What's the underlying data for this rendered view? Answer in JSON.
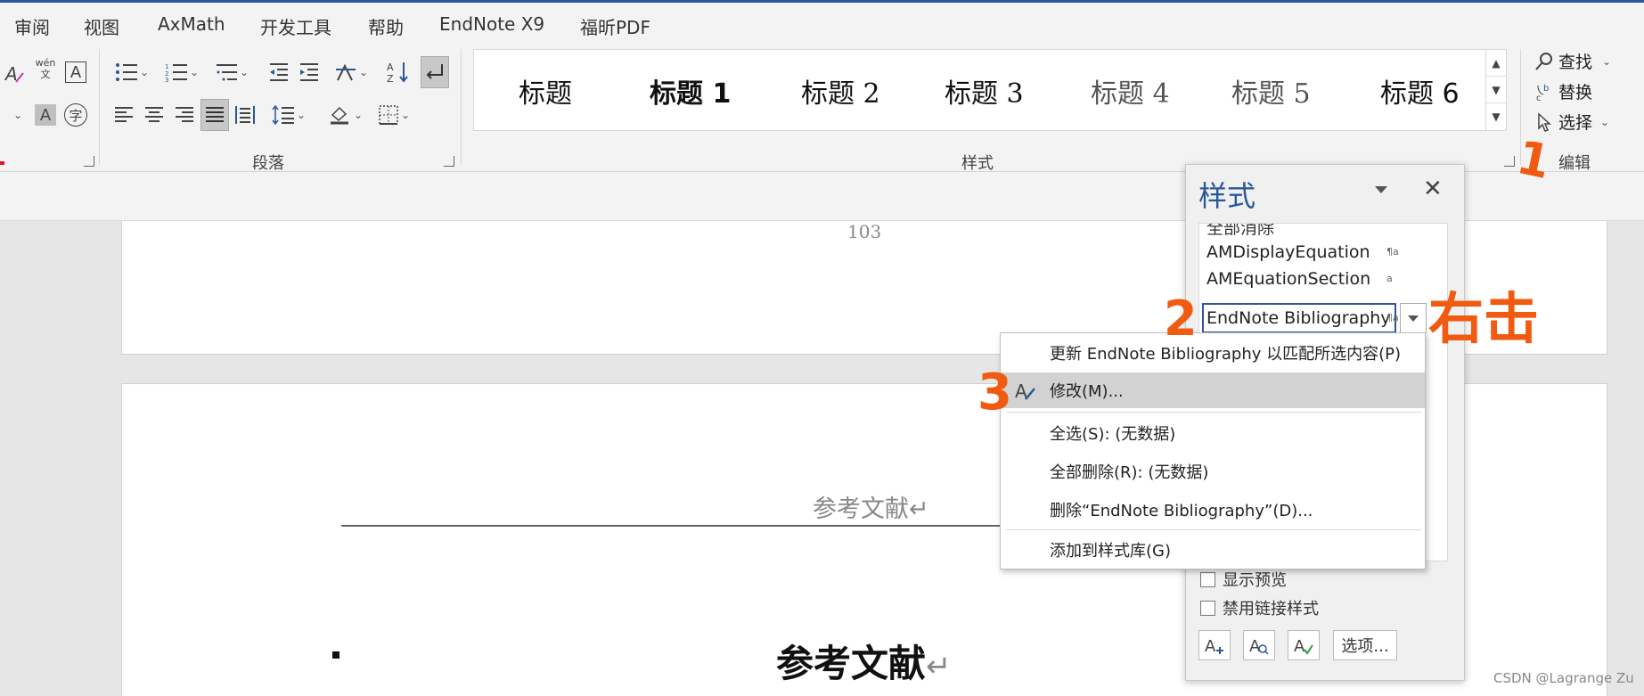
{
  "menu": {
    "tabs": [
      "审阅",
      "视图",
      "AxMath",
      "开发工具",
      "帮助",
      "EndNote X9",
      "福昕PDF"
    ]
  },
  "ribbon": {
    "paragraph_group_label": "段落",
    "styles_group_label": "样式",
    "editing_group_label": "编辑",
    "style_gallery": [
      "标题",
      "标题 1",
      "标题 2",
      "标题 3",
      "标题 4",
      "标题 5",
      "标题 6"
    ],
    "editing": {
      "find": "查找",
      "replace": "替换",
      "select": "选择"
    },
    "font_glyphs": {
      "phonetic_top": "wén",
      "phonetic_bottom": "文",
      "char_border": "A",
      "shaded": "A",
      "enclose": "字"
    }
  },
  "document": {
    "page_number": "103",
    "header_text": "参考文献",
    "heading_text": "参考文献"
  },
  "styles_pane": {
    "title": "样式",
    "partial_item": "全部消除",
    "items": [
      {
        "name": "AMDisplayEquation",
        "mark": "¶a"
      },
      {
        "name": "AMEquationSection",
        "mark": "a"
      },
      {
        "name": "EndNote Bibliography",
        "mark": "¶a"
      }
    ],
    "show_preview": "显示预览",
    "disable_linked": "禁用链接样式",
    "options_button": "选项..."
  },
  "context_menu": {
    "items": [
      "更新 EndNote Bibliography 以匹配所选内容(P)",
      "修改(M)...",
      "全选(S): (无数据)",
      "全部删除(R): (无数据)",
      "删除“EndNote Bibliography”(D)...",
      "添加到样式库(G)"
    ]
  },
  "annotations": {
    "step1": "1",
    "step2": "2",
    "step3": "3",
    "right_click": "右击"
  },
  "watermark": "CSDN @Lagrange Zu",
  "colors": {
    "accent": "#2b579a",
    "annotation": "#f15a11"
  }
}
